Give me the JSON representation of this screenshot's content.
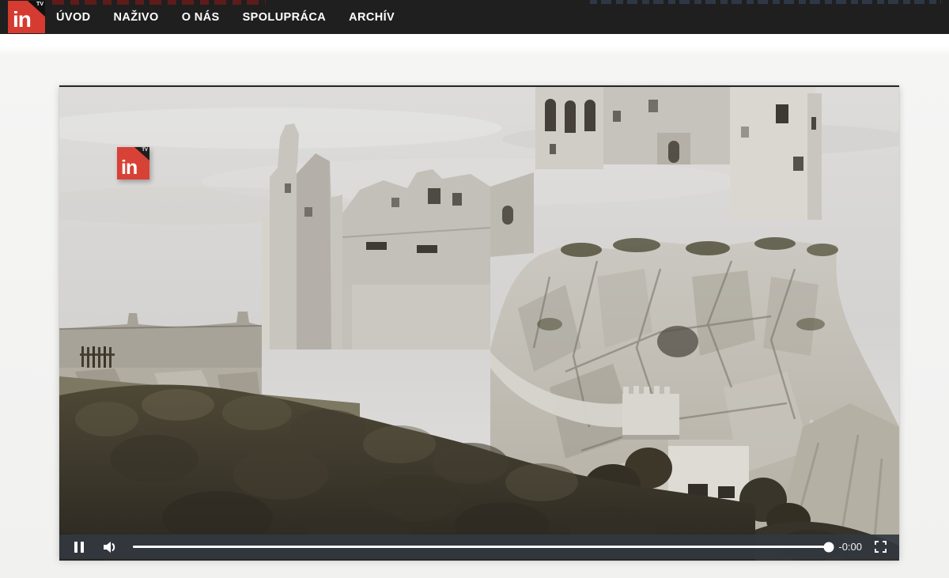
{
  "nav": {
    "logo": {
      "text": "in",
      "superscript": "TV"
    },
    "items": [
      {
        "label": "ÚVOD"
      },
      {
        "label": "NAŽIVO"
      },
      {
        "label": "O NÁS"
      },
      {
        "label": "SPOLUPRÁCA"
      },
      {
        "label": "ARCHÍV"
      }
    ]
  },
  "player": {
    "watermark": {
      "text": "in",
      "superscript": "TV"
    },
    "controls": {
      "playback_state": "playing",
      "time_remaining": "-0:00",
      "progress_percent": 100,
      "icons": {
        "pause": "pause-icon",
        "volume": "speaker-icon",
        "fullscreen": "fullscreen-icon"
      }
    }
  },
  "colors": {
    "brand_red": "#d53b30",
    "nav_background": "#1f1f1f",
    "control_bar": "#32383f",
    "page_background": "#f3f3f2"
  }
}
